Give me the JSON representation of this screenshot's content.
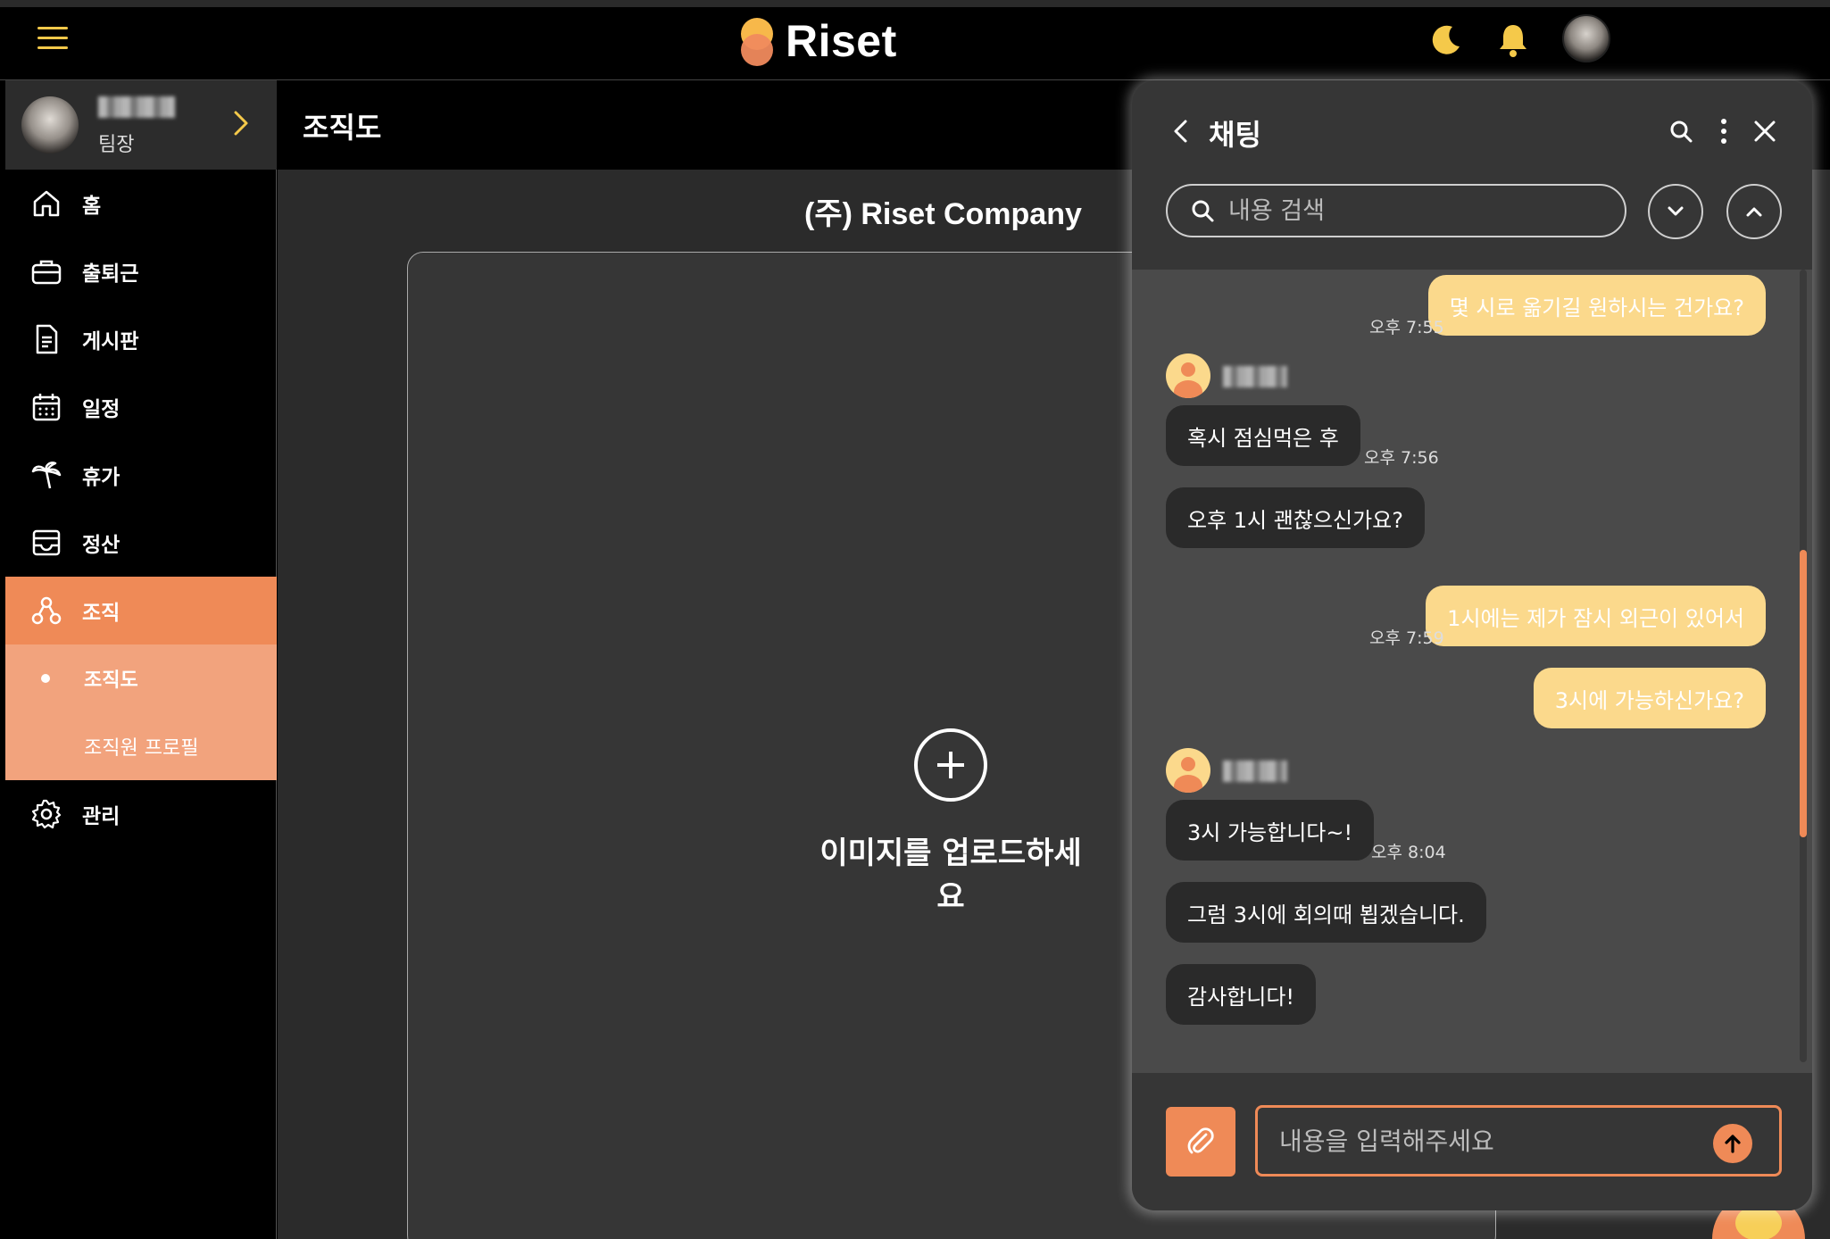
{
  "app": {
    "name": "Riset",
    "accent": "#ef8a57",
    "accent_light": "#f2a37d",
    "bubble_me_color": "#fbd98c",
    "icon_color": "#f5c94a"
  },
  "topbar": {
    "menu_icon": "hamburger-icon",
    "theme_icon": "moon-icon",
    "notification_icon": "bell-icon"
  },
  "profile": {
    "role": "팀장"
  },
  "sidebar": {
    "items": [
      {
        "label": "홈",
        "icon": "home-icon"
      },
      {
        "label": "출퇴근",
        "icon": "briefcase-icon"
      },
      {
        "label": "게시판",
        "icon": "document-icon"
      },
      {
        "label": "일정",
        "icon": "calendar-icon"
      },
      {
        "label": "휴가",
        "icon": "palm-tree-icon"
      },
      {
        "label": "정산",
        "icon": "envelope-icon"
      },
      {
        "label": "조직",
        "icon": "org-icon"
      },
      {
        "label": "관리",
        "icon": "gear-icon"
      }
    ],
    "sub_items": [
      {
        "label": "조직도"
      },
      {
        "label": "조직원 프로필"
      }
    ]
  },
  "page": {
    "title": "조직도",
    "company": "(주) Riset Company",
    "upload_text": "이미지를 업로드하세요"
  },
  "chat": {
    "title": "채팅",
    "search_placeholder": "내용 검색",
    "input_placeholder": "내용을 입력해주세요",
    "messages": [
      {
        "from": "me",
        "text": "몇 시로 옮기길 원하시는 건가요?",
        "time": "오후 7:55"
      },
      {
        "from": "them",
        "text": "혹시 점심먹은 후",
        "time": "오후 7:56"
      },
      {
        "from": "them",
        "text": "오후 1시 괜찮으신가요?",
        "time": ""
      },
      {
        "from": "me",
        "text": "1시에는 제가 잠시 외근이 있어서",
        "time": "오후 7:59"
      },
      {
        "from": "me",
        "text": "3시에 가능하신가요?",
        "time": ""
      },
      {
        "from": "them",
        "text": "3시 가능합니다~!",
        "time": "오후 8:04"
      },
      {
        "from": "them",
        "text": "그럼 3시에 회의때 뵙겠습니다.",
        "time": ""
      },
      {
        "from": "them",
        "text": "감사합니다!",
        "time": ""
      }
    ]
  }
}
